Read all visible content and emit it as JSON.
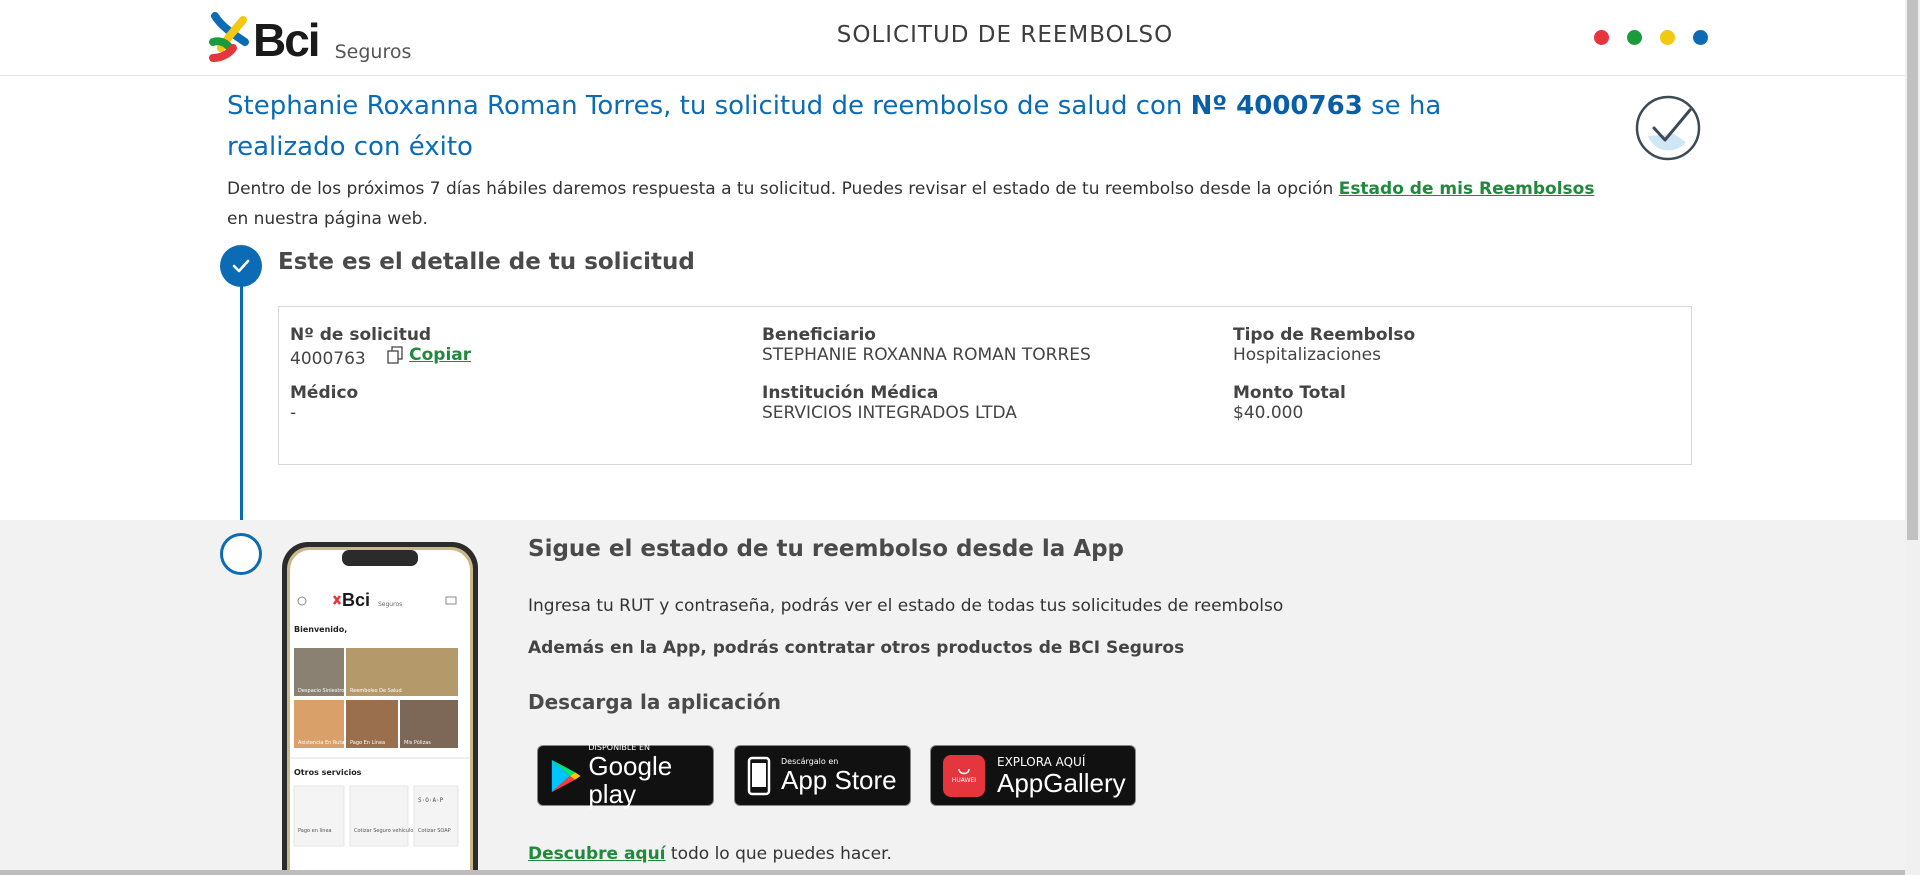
{
  "header": {
    "logo_word": "Bci",
    "logo_sub": "Seguros",
    "title": "SOLICITUD DE REEMBOLSO",
    "dot_colors": [
      "#e5363d",
      "#1b9c3c",
      "#f2c811",
      "#0b6cb5"
    ]
  },
  "confirmation": {
    "headline_pre": "Stephanie Roxanna Roman Torres, tu solicitud de reembolso de salud con ",
    "headline_number": "Nº 4000763",
    "headline_post": " se ha realizado con éxito",
    "para_pre": "Dentro de los próximos 7 días hábiles daremos respuesta a tu solicitud. Puedes revisar el estado de tu reembolso desde la opción ",
    "para_link": "Estado de mis Reembolsos",
    "para_post": " en nuestra página web."
  },
  "detail": {
    "title": "Este es el detalle de tu solicitud",
    "solicitud_label": "Nº de solicitud",
    "solicitud_value": "4000763",
    "copy_label": "Copiar",
    "beneficiario_label": "Beneficiario",
    "beneficiario_value": "STEPHANIE ROXANNA ROMAN TORRES",
    "tipo_label": "Tipo de Reembolso",
    "tipo_value": "Hospitalizaciones",
    "medico_label": "Médico",
    "medico_value": "-",
    "institucion_label": "Institución Médica",
    "institucion_value": "SERVICIOS INTEGRADOS LTDA",
    "monto_label": "Monto Total",
    "monto_value": "$40.000"
  },
  "app_section": {
    "title": "Sigue el estado de tu reembolso desde la App",
    "p1": "Ingresa tu RUT y contraseña, podrás ver el estado de todas tus solicitudes de reembolso",
    "p2": "Además en la App, podrás contratar otros productos de BCI Seguros",
    "download_title": "Descarga la aplicación",
    "google_small": "DISPONIBLE EN",
    "google_big": "Google play",
    "apple_small": "Descárgalo en",
    "apple_big": "App Store",
    "huawei_small": "EXPLORA AQUÍ",
    "huawei_big": "AppGallery",
    "huawei_brand": "HUAWEI",
    "discover_link": "Descubre aquí",
    "discover_post": " todo lo que puedes hacer."
  },
  "phone": {
    "logo": "Bci",
    "logo_sub": "Seguros",
    "welcome": "Bienvenido,",
    "tiles": [
      "Despacio Siniestro",
      "Reembolso De Salud",
      "Asistencia En Ruta",
      "Pago En Línea",
      "Mis Pólizas"
    ],
    "other_services": "Otros servicios",
    "services": [
      "Pago en línea",
      "Cotizar Seguro vehículo",
      "Cotizar SOAP"
    ],
    "soap": "S·O·A·P"
  }
}
